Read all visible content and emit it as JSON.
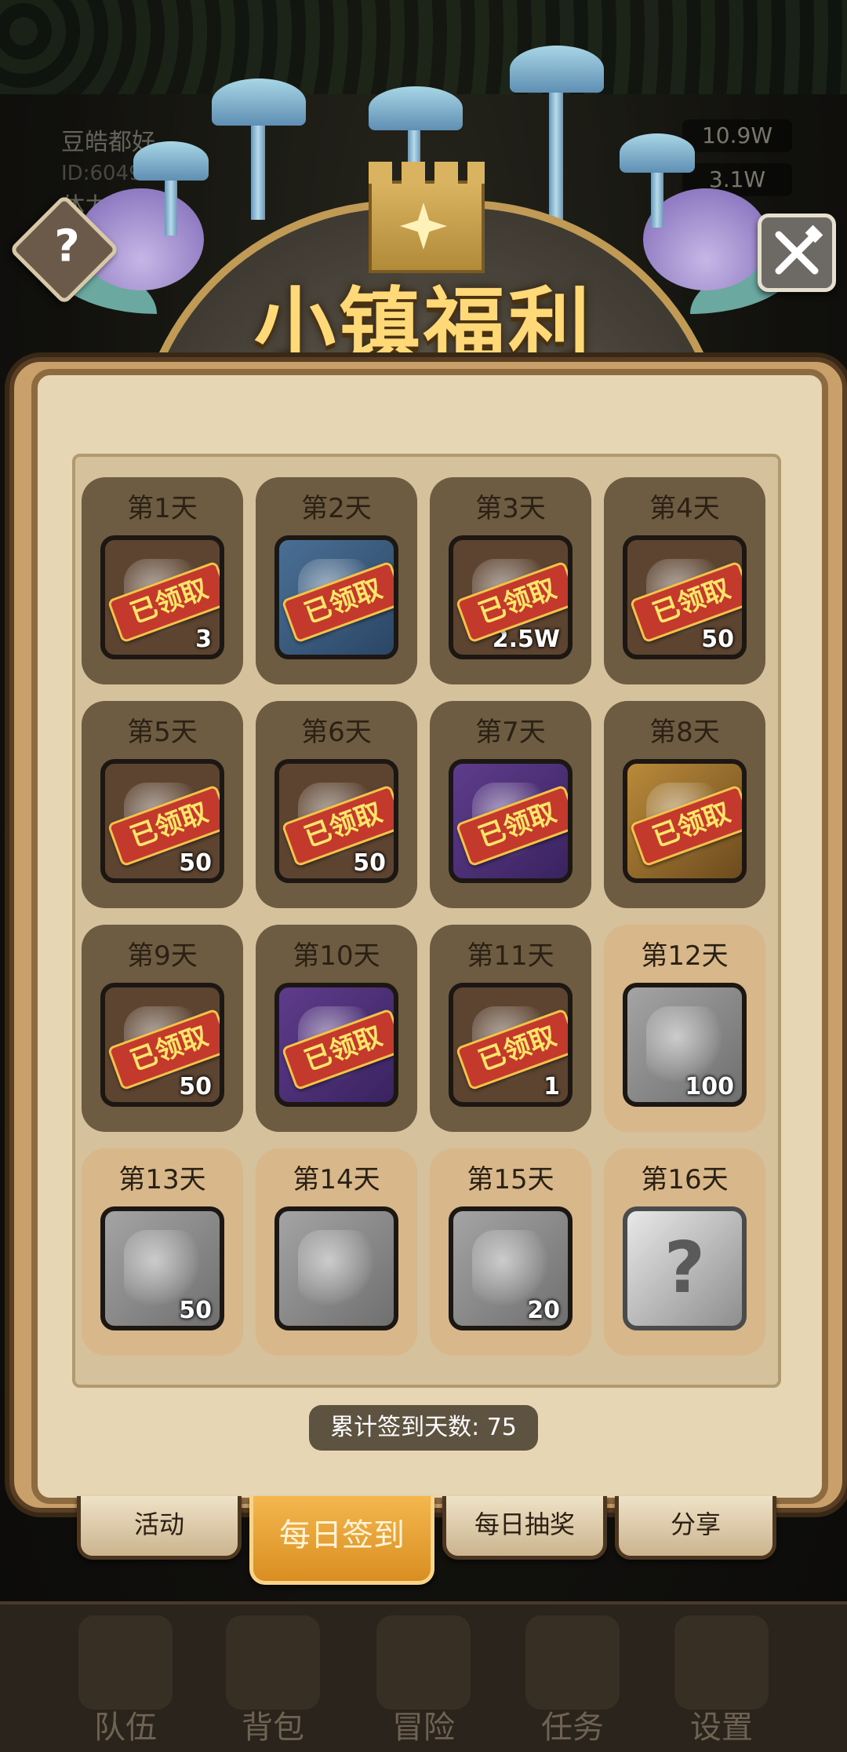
{
  "hud": {
    "player_name": "豆皓都好",
    "player_id": "ID:604955",
    "stamina_label": "体力",
    "resource_1": "10.9W",
    "resource_2": "3.1W"
  },
  "title": "小镇福利",
  "days": [
    {
      "label": "第1天",
      "qty": "3",
      "claimed": true,
      "frame": "brown",
      "icon": "blue-orb-icon"
    },
    {
      "label": "第2天",
      "qty": "",
      "claimed": true,
      "frame": "blue",
      "icon": "blue-chest-icon"
    },
    {
      "label": "第3天",
      "qty": "2.5W",
      "claimed": true,
      "frame": "brown",
      "icon": "gold-coin-bag-icon"
    },
    {
      "label": "第4天",
      "qty": "50",
      "claimed": true,
      "frame": "brown",
      "icon": "blue-crystal-icon"
    },
    {
      "label": "第5天",
      "qty": "50",
      "claimed": true,
      "frame": "brown",
      "icon": "iron-ore-icon"
    },
    {
      "label": "第6天",
      "qty": "50",
      "claimed": true,
      "frame": "brown",
      "icon": "copper-ore-icon"
    },
    {
      "label": "第7天",
      "qty": "",
      "claimed": true,
      "frame": "purple",
      "icon": "purple-chest-icon"
    },
    {
      "label": "第8天",
      "qty": "",
      "claimed": true,
      "frame": "gold",
      "icon": "gold-chest-icon"
    },
    {
      "label": "第9天",
      "qty": "50",
      "claimed": true,
      "frame": "brown",
      "icon": "iron-bar-icon"
    },
    {
      "label": "第10天",
      "qty": "",
      "claimed": true,
      "frame": "purple",
      "icon": "sword-icon"
    },
    {
      "label": "第11天",
      "qty": "1",
      "claimed": true,
      "frame": "brown",
      "icon": "sparkle-item-icon"
    },
    {
      "label": "第12天",
      "qty": "100",
      "claimed": false,
      "frame": "grey",
      "icon": "silver-rune-stone-icon"
    },
    {
      "label": "第13天",
      "qty": "50",
      "claimed": false,
      "frame": "grey",
      "icon": "wood-log-icon"
    },
    {
      "label": "第14天",
      "qty": "",
      "claimed": false,
      "frame": "grey",
      "icon": "backpack-icon"
    },
    {
      "label": "第15天",
      "qty": "20",
      "claimed": false,
      "frame": "grey",
      "icon": "dark-rune-stone-icon"
    },
    {
      "label": "第16天",
      "qty": "",
      "claimed": false,
      "frame": "silver",
      "icon": "mystery-question-icon"
    }
  ],
  "claimed_stamp": "已领取",
  "counter_text": "累计签到天数: 75",
  "tabs": {
    "activity": "活动",
    "daily_signin": "每日签到",
    "daily_lottery": "每日抽奖",
    "share": "分享"
  },
  "nav": {
    "team": "队伍",
    "backpack": "背包",
    "adventure": "冒险",
    "tasks": "任务",
    "settings": "设置"
  },
  "colors": {
    "title": "#ffd878",
    "stamp_bg": "#c33a2c",
    "stamp_text": "#ffe56a",
    "active_tab": "#f4b74e"
  }
}
